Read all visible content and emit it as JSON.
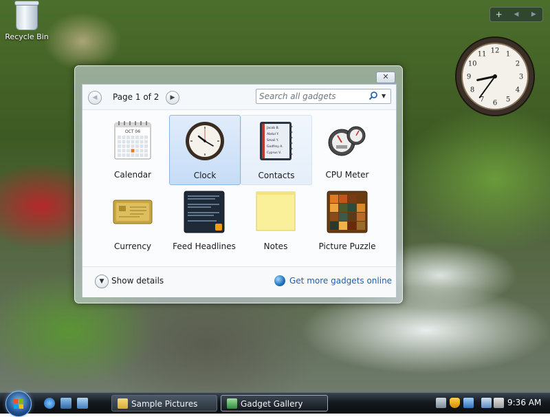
{
  "desktop": {
    "recycle_bin_label": "Recycle Bin",
    "sidebar_controls": [
      "+",
      "◀",
      "▶"
    ],
    "clock": {
      "hour": 8,
      "minute": 36,
      "numbers": [
        "12",
        "1",
        "2",
        "3",
        "4",
        "5",
        "6",
        "7",
        "8",
        "9",
        "10",
        "11"
      ]
    }
  },
  "dialog": {
    "close_label": "✕",
    "page_label": "Page 1 of 2",
    "search_placeholder": "Search all gadgets",
    "gadgets": [
      {
        "label": "Calendar",
        "icon": "calendar-icon",
        "state": "normal"
      },
      {
        "label": "Clock",
        "icon": "clock-icon",
        "state": "selected"
      },
      {
        "label": "Contacts",
        "icon": "contacts-icon",
        "state": "hover"
      },
      {
        "label": "CPU Meter",
        "icon": "cpu-meter-icon",
        "state": "normal"
      },
      {
        "label": "Currency",
        "icon": "currency-icon",
        "state": "normal"
      },
      {
        "label": "Feed Headlines",
        "icon": "feed-headlines-icon",
        "state": "normal"
      },
      {
        "label": "Notes",
        "icon": "notes-icon",
        "state": "normal"
      },
      {
        "label": "Picture Puzzle",
        "icon": "picture-puzzle-icon",
        "state": "normal"
      }
    ],
    "calendar_month": "OCT 06",
    "contacts_names": [
      "Jacob B.",
      "Abdul Y.",
      "Smail Y.",
      "Godfrey A.",
      "Cyprus V."
    ],
    "show_details_label": "Show details",
    "more_link_label": "Get more gadgets online"
  },
  "taskbar": {
    "buttons": [
      {
        "label": "Sample Pictures",
        "icon": "folder-icon"
      },
      {
        "label": "Gadget Gallery",
        "icon": "gadget-gallery-icon"
      }
    ],
    "time": "9:36 AM"
  },
  "colors": {
    "selection": "#c6dcf6",
    "link": "#1b5fb5",
    "taskbar": "#151a20"
  }
}
